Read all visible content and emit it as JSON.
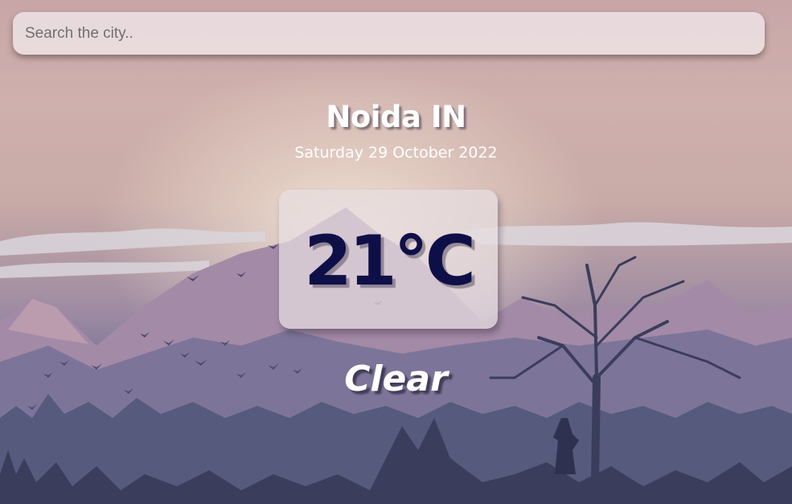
{
  "search": {
    "placeholder": "Search the city..",
    "value": ""
  },
  "location": {
    "city": "Noida IN",
    "date": "Saturday 29 October 2022"
  },
  "weather": {
    "temperature": "21°C",
    "condition": "Clear"
  },
  "colors": {
    "temperature_text": "#0f0f48",
    "heading_text": "#ffffff",
    "sky_top": "#c8a6a8",
    "mountain": "#7a6f97",
    "forest": "#3b3d5c"
  }
}
